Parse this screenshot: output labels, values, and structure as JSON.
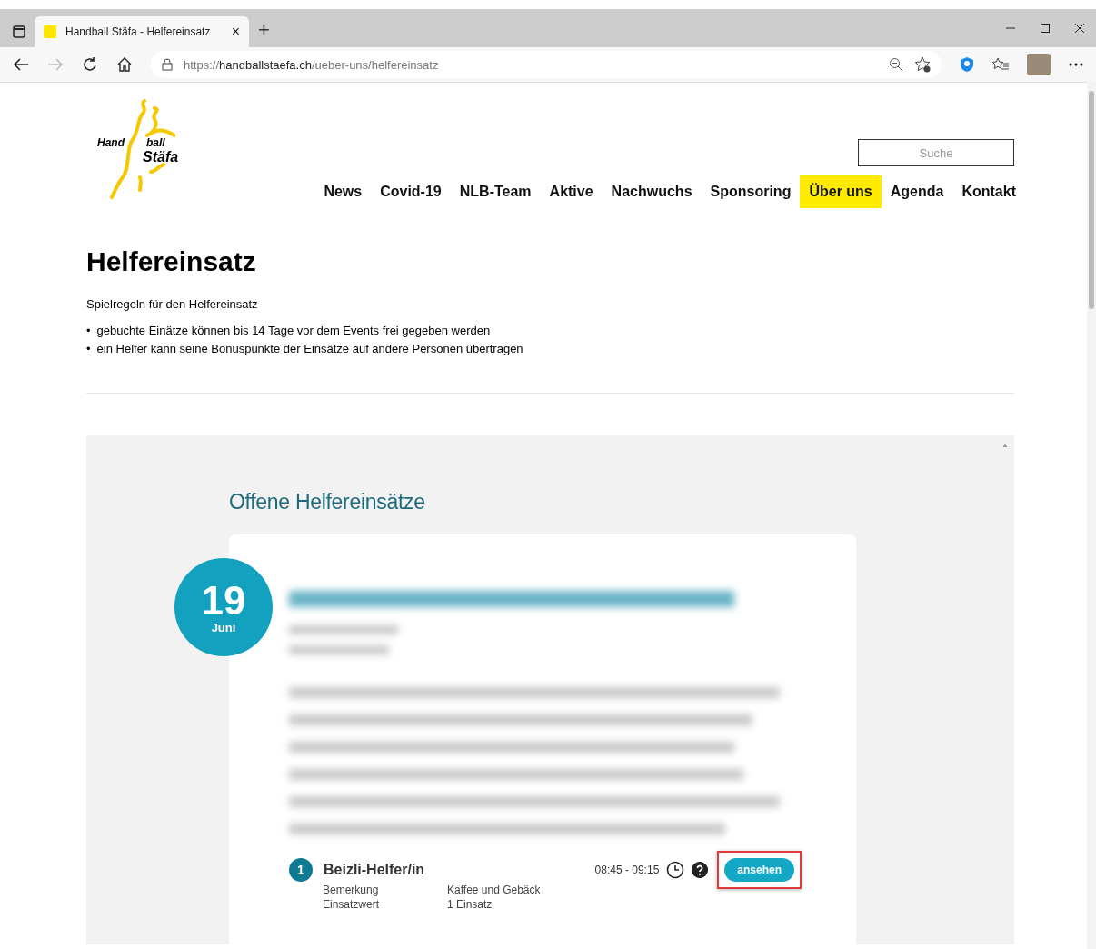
{
  "browser": {
    "tab_title": "Handball Stäfa - Helfereinsatz",
    "tab_close": "×",
    "new_tab": "+",
    "url": {
      "scheme": "https://",
      "host": "handballstaefa.ch",
      "path": "/ueber-uns/helfereinsatz"
    }
  },
  "site": {
    "logo": {
      "word_1": "Hand",
      "word_2": "ball",
      "word_3": "Stäfa"
    },
    "search": {
      "placeholder": "Suche"
    },
    "nav": [
      {
        "label": "News",
        "selected": false
      },
      {
        "label": "Covid-19",
        "selected": false
      },
      {
        "label": "NLB-Team",
        "selected": false
      },
      {
        "label": "Aktive",
        "selected": false
      },
      {
        "label": "Nachwuchs",
        "selected": false
      },
      {
        "label": "Sponsoring",
        "selected": false
      },
      {
        "label": "Über uns",
        "selected": true
      },
      {
        "label": "Agenda",
        "selected": false
      },
      {
        "label": "Kontakt",
        "selected": false
      }
    ]
  },
  "page": {
    "title": "Helfereinsatz",
    "intro": "Spielregeln für den Helfereinsatz",
    "bullet": "•",
    "rules": [
      "gebuchte Einätze können bis 14 Tage vor dem Events frei gegeben werden",
      "ein Helfer kann seine Bonuspunkte der Einsätze auf andere Personen übertragen"
    ]
  },
  "events": {
    "scroll_up": "▲",
    "heading": "Offene Helfereinsätze",
    "items": [
      {
        "day": "19",
        "month": "Juni",
        "shifts": [
          {
            "number": "1",
            "title": "Beizli-Helfer/in",
            "time": "08:45 - 09:15",
            "button": "ansehen",
            "highlighted": true,
            "details": [
              {
                "label": "Bemerkung",
                "value": "Kaffee und Gebäck"
              },
              {
                "label": "Einsatzwert",
                "value": "1 Einsatz"
              }
            ]
          }
        ]
      }
    ]
  }
}
